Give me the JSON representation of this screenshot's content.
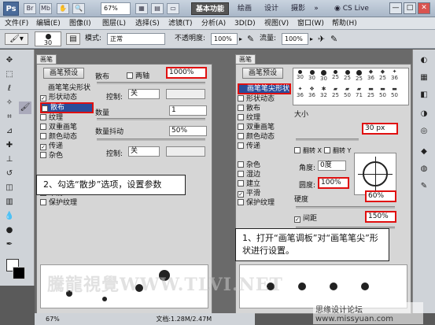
{
  "titlebar": {
    "app_logo": "Ps",
    "zoom": "67%",
    "workspaces": [
      "基本功能",
      "绘画",
      "设计",
      "摄影"
    ],
    "more": "»",
    "cs_live": "CS Live",
    "win_buttons": [
      "—",
      "□",
      "✕"
    ]
  },
  "menubar": [
    "文件(F)",
    "编辑(E)",
    "图像(I)",
    "图层(L)",
    "选择(S)",
    "滤镜(T)",
    "分析(A)",
    "3D(D)",
    "视图(V)",
    "窗口(W)",
    "帮助(H)"
  ],
  "options": {
    "brush_size": "30",
    "mode_label": "模式:",
    "mode_value": "正常",
    "opacity_label": "不透明度:",
    "opacity_value": "100%",
    "flow_label": "流量:",
    "flow_value": "100%"
  },
  "left_panel": {
    "tab": "画笔",
    "preset_button": "画笔预设",
    "items": [
      {
        "label": "画笔笔尖形状",
        "checked": false
      },
      {
        "label": "形状动态",
        "checked": true
      },
      {
        "label": "散布",
        "checked": true,
        "selected": true
      },
      {
        "label": "纹理",
        "checked": false
      },
      {
        "label": "双重画笔",
        "checked": false
      },
      {
        "label": "颜色动态",
        "checked": false
      },
      {
        "label": "传递",
        "checked": true
      },
      {
        "label": "杂色",
        "checked": false
      },
      {
        "label": "湿边",
        "checked": false
      },
      {
        "label": "建立",
        "checked": false
      },
      {
        "label": "平滑",
        "checked": false
      },
      {
        "label": "保护纹理",
        "checked": false
      }
    ],
    "scatter_label": "散布",
    "both_axes_label": "两轴",
    "scatter_value": "1000%",
    "control_label": "控制:",
    "control_value": "关",
    "count_label": "数量",
    "count_value": "1",
    "count_jitter_label": "数量抖动",
    "count_jitter_value": "50%",
    "control2_label": "控制:",
    "control2_value": "关"
  },
  "right_panel": {
    "tab": "画笔",
    "preset_button": "画笔预设",
    "items": [
      {
        "label": "画笔笔尖形状",
        "checked": false,
        "selected": true
      },
      {
        "label": "形状动态",
        "checked": false
      },
      {
        "label": "散布",
        "checked": false
      },
      {
        "label": "纹理",
        "checked": false
      },
      {
        "label": "双重画笔",
        "checked": false
      },
      {
        "label": "颜色动态",
        "checked": false
      },
      {
        "label": "传递",
        "checked": false
      },
      {
        "label": "杂色",
        "checked": false
      },
      {
        "label": "湿边",
        "checked": false
      },
      {
        "label": "建立",
        "checked": false
      },
      {
        "label": "平滑",
        "checked": true
      },
      {
        "label": "保护纹理",
        "checked": false
      }
    ],
    "brush_sizes": [
      "30",
      "30",
      "30",
      "25",
      "25",
      "25",
      "36",
      "25",
      "36",
      "36",
      "36",
      "32",
      "25",
      "50",
      "71",
      "25",
      "50",
      "50"
    ],
    "size_label": "大小",
    "size_value": "30 px",
    "flip_x": "翻转 X",
    "flip_y": "翻转 Y",
    "angle_label": "角度:",
    "angle_value": "0度",
    "roundness_label": "圆度:",
    "roundness_value": "100%",
    "hardness_label": "硬度",
    "hardness_value": "60%",
    "spacing_label": "间距",
    "spacing_value": "150%"
  },
  "callouts": {
    "step2": "2、勾选“散步”选项，设置参数",
    "step1": "1、打开“画笔调板”对“画笔笔尖”形状进行设置。"
  },
  "status": "67%",
  "status_doc": "文档:1.28M/2.47M",
  "watermark": "騰龍視覺WWW.TLVI.NET",
  "watermark2": "思缘设计论坛 www.missyuan.com",
  "colors": {
    "highlight": "#e01010",
    "selected": "#2a4d9a"
  }
}
